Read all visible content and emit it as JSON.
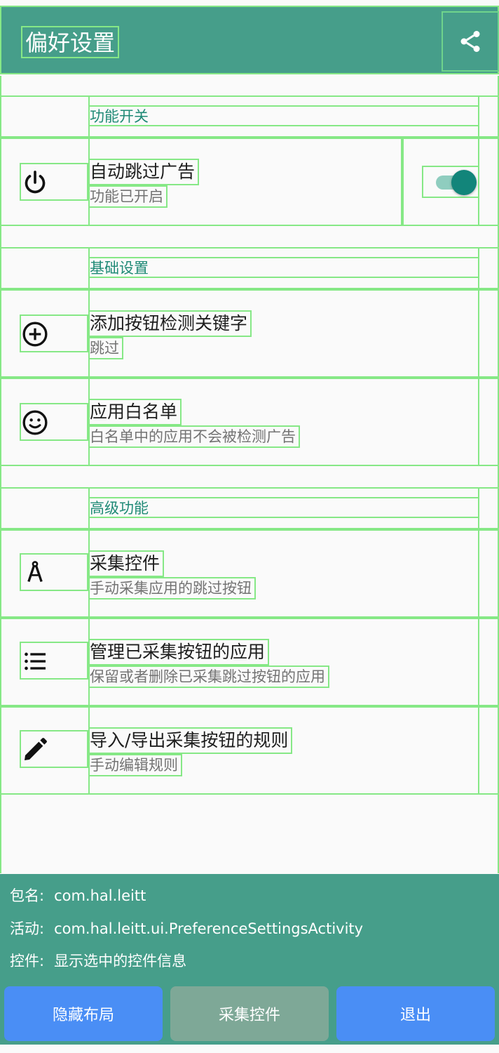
{
  "appbar": {
    "title": "偏好设置"
  },
  "sections": [
    {
      "title": "功能开关",
      "items": [
        {
          "icon": "power-icon",
          "title": "自动跳过广告",
          "summary": "功能已开启",
          "toggle_on": true
        }
      ]
    },
    {
      "title": "基础设置",
      "items": [
        {
          "icon": "add-circle-icon",
          "title": "添加按钮检测关键字",
          "summary": "跳过"
        },
        {
          "icon": "smiley-icon",
          "title": "应用白名单",
          "summary": "白名单中的应用不会被检测广告"
        }
      ]
    },
    {
      "title": "高级功能",
      "items": [
        {
          "icon": "compass-icon",
          "title": "采集控件",
          "summary": "手动采集应用的跳过按钮"
        },
        {
          "icon": "list-icon",
          "title": "管理已采集按钮的应用",
          "summary": "保留或者删除已采集跳过按钮的应用"
        },
        {
          "icon": "pencil-icon",
          "title": "导入/导出采集按钮的规则",
          "summary": "手动编辑规则"
        }
      ]
    }
  ],
  "panel": {
    "package_label": "包名:",
    "package_value": "com.hal.leitt",
    "activity_label": "活动:",
    "activity_value": "com.hal.leitt.ui.PreferenceSettingsActivity",
    "widget_label": "控件:",
    "widget_value": "显示选中的控件信息",
    "buttons": {
      "hide_layout": "隐藏布局",
      "collect_widget": "采集控件",
      "exit": "退出"
    }
  },
  "colors": {
    "primary": "#469e8a",
    "accent": "#12857a",
    "section_title": "#1f8a76",
    "button_blue": "#4a8ef5",
    "button_gray": "#7ea897",
    "overlay_frame": "#86e886"
  }
}
